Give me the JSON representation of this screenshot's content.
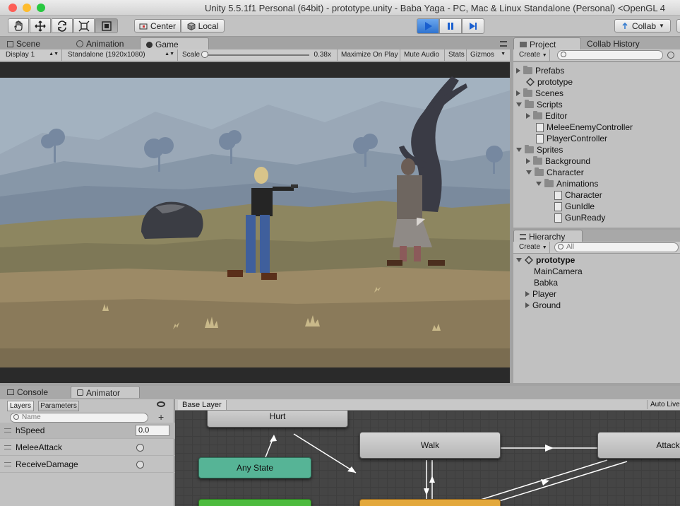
{
  "window": {
    "title": "Unity 5.5.1f1 Personal (64bit) - prototype.unity - Baba Yaga - PC, Mac & Linux Standalone (Personal) <OpenGL 4"
  },
  "toolbar": {
    "pivot_label": "Center",
    "space_label": "Local",
    "collab_label": "Collab"
  },
  "scene_tabs": {
    "items": [
      {
        "label": "Scene"
      },
      {
        "label": "Animation"
      },
      {
        "label": "Game"
      }
    ]
  },
  "game_bar": {
    "display": "Display 1",
    "resolution": "Standalone (1920x1080)",
    "scale_label": "Scale",
    "scale_value": "0.38x",
    "maximize": "Maximize On Play",
    "mute": "Mute Audio",
    "stats": "Stats",
    "gizmos": "Gizmos"
  },
  "project": {
    "tabs": [
      "Project",
      "Collab History"
    ],
    "create_label": "Create",
    "items": [
      {
        "label": "Prefabs"
      },
      {
        "label": "prototype"
      },
      {
        "label": "Scenes"
      },
      {
        "label": "Scripts"
      },
      {
        "label": "Editor"
      },
      {
        "label": "MeleeEnemyController"
      },
      {
        "label": "PlayerController"
      },
      {
        "label": "Sprites"
      },
      {
        "label": "Background"
      },
      {
        "label": "Character"
      },
      {
        "label": "Animations"
      },
      {
        "label": "Character"
      },
      {
        "label": "GunIdle"
      },
      {
        "label": "GunReady"
      }
    ]
  },
  "hierarchy": {
    "tab": "Hierarchy",
    "create_label": "Create",
    "search_placeholder": "All",
    "items": [
      {
        "label": "prototype"
      },
      {
        "label": "MainCamera"
      },
      {
        "label": "Babka"
      },
      {
        "label": "Player"
      },
      {
        "label": "Ground"
      }
    ]
  },
  "bottom_tabs": {
    "items": [
      {
        "label": "Console"
      },
      {
        "label": "Animator"
      }
    ]
  },
  "animator": {
    "sub_tabs": [
      "Layers",
      "Parameters"
    ],
    "search_placeholder": "Name",
    "params": [
      {
        "name": "hSpeed",
        "value": "0.0"
      },
      {
        "name": "MeleeAttack"
      },
      {
        "name": "ReceiveDamage"
      }
    ],
    "breadcrumb": "Base Layer",
    "auto_live": "Auto Live",
    "nodes": [
      {
        "label": "Hurt"
      },
      {
        "label": "Walk"
      },
      {
        "label": "Attack"
      },
      {
        "label": "Any State"
      }
    ]
  },
  "colors": {
    "any_state": "#4ea98a",
    "entry": "#43b33f",
    "default_state": "#e0a53b",
    "play_active": "#3a88e8",
    "sky": "#9eaebd",
    "ground_grass": "#8d8660",
    "ground_dirt": "#9c8a66"
  }
}
